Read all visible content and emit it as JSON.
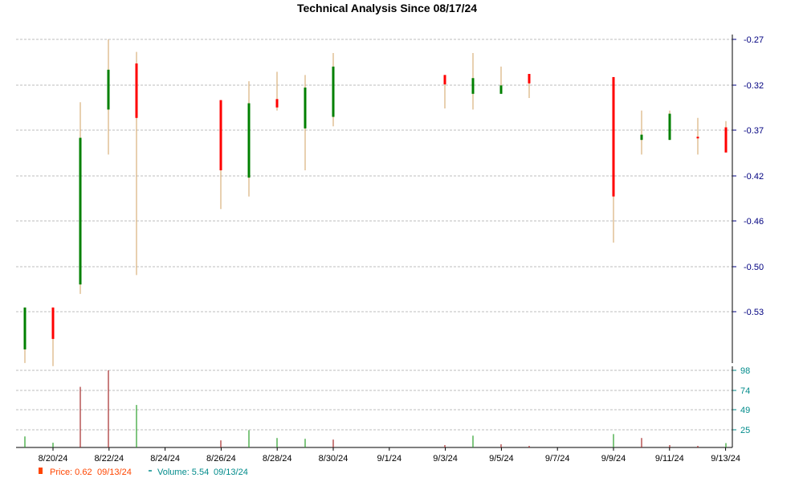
{
  "chart_data": {
    "type": "candlestick",
    "title": "Technical Analysis Since 08/17/24",
    "colors": {
      "up": "#008000",
      "down": "#ff0000",
      "wick": "#d2a060",
      "volume_up": "#2ca02c",
      "volume_down": "#a52a2a",
      "axis_price": "#000080",
      "axis_volume": "#008b8b",
      "grid": "#bdbdbd",
      "legend_price": "#ff4500",
      "legend_volume": "#008b8b"
    },
    "x_labels": [
      "8/20/24",
      "8/22/24",
      "8/24/24",
      "8/26/24",
      "8/28/24",
      "8/30/24",
      "9/1/24",
      "9/3/24",
      "9/5/24",
      "9/7/24",
      "9/9/24",
      "9/11/24",
      "9/13/24"
    ],
    "price_axis": {
      "ticks": [
        "-0.27",
        "-0.32",
        "-0.37",
        "-0.42",
        "-0.46",
        "-0.50",
        "-0.53"
      ],
      "range": [
        -0.27,
        -0.53
      ],
      "grid": true
    },
    "volume_axis": {
      "ticks": [
        "98",
        "74",
        "49",
        "25"
      ],
      "range": [
        0,
        98
      ],
      "grid": true
    },
    "candles": [
      {
        "date": "8/19",
        "open": -0.566,
        "close": -0.526,
        "high": -0.526,
        "low": -0.579,
        "dir": "up"
      },
      {
        "date": "8/20",
        "open": -0.526,
        "close": -0.556,
        "high": -0.526,
        "low": -0.582,
        "dir": "down"
      },
      {
        "date": "8/21",
        "open": -0.504,
        "close": -0.364,
        "high": -0.33,
        "low": -0.513,
        "dir": "up"
      },
      {
        "date": "8/22",
        "open": -0.337,
        "close": -0.299,
        "high": -0.27,
        "low": -0.38,
        "dir": "up"
      },
      {
        "date": "8/23",
        "open": -0.293,
        "close": -0.345,
        "high": -0.282,
        "low": -0.495,
        "dir": "down"
      },
      {
        "date": "8/26",
        "open": -0.328,
        "close": -0.395,
        "high": -0.328,
        "low": -0.432,
        "dir": "down"
      },
      {
        "date": "8/27",
        "open": -0.402,
        "close": -0.331,
        "high": -0.31,
        "low": -0.42,
        "dir": "up"
      },
      {
        "date": "8/28",
        "open": -0.327,
        "close": -0.335,
        "high": -0.301,
        "low": -0.338,
        "dir": "down"
      },
      {
        "date": "8/29",
        "open": -0.355,
        "close": -0.316,
        "high": -0.304,
        "low": -0.395,
        "dir": "up"
      },
      {
        "date": "8/30",
        "open": -0.344,
        "close": -0.296,
        "high": -0.283,
        "low": -0.353,
        "dir": "up"
      },
      {
        "date": "9/3",
        "open": -0.304,
        "close": -0.313,
        "high": -0.304,
        "low": -0.336,
        "dir": "down"
      },
      {
        "date": "9/4",
        "open": -0.322,
        "close": -0.307,
        "high": -0.283,
        "low": -0.337,
        "dir": "up"
      },
      {
        "date": "9/5",
        "open": -0.322,
        "close": -0.314,
        "high": -0.296,
        "low": -0.322,
        "dir": "up"
      },
      {
        "date": "9/6",
        "open": -0.303,
        "close": -0.312,
        "high": -0.303,
        "low": -0.326,
        "dir": "down"
      },
      {
        "date": "9/9",
        "open": -0.306,
        "close": -0.42,
        "high": -0.306,
        "low": -0.464,
        "dir": "down"
      },
      {
        "date": "9/10",
        "open": -0.366,
        "close": -0.361,
        "high": -0.338,
        "low": -0.38,
        "dir": "up"
      },
      {
        "date": "9/11",
        "open": -0.366,
        "close": -0.341,
        "high": -0.338,
        "low": -0.366,
        "dir": "up"
      },
      {
        "date": "9/12",
        "open": -0.363,
        "close": -0.363,
        "high": -0.345,
        "low": -0.38,
        "dir": "down"
      },
      {
        "date": "9/13",
        "open": -0.354,
        "close": -0.378,
        "high": -0.348,
        "low": -0.378,
        "dir": "down"
      }
    ],
    "volume": [
      {
        "date": "8/19",
        "value": 14,
        "dir": "up"
      },
      {
        "date": "8/20",
        "value": 6,
        "dir": "up"
      },
      {
        "date": "8/21",
        "value": 77,
        "dir": "down"
      },
      {
        "date": "8/22",
        "value": 98,
        "dir": "down"
      },
      {
        "date": "8/23",
        "value": 54,
        "dir": "up"
      },
      {
        "date": "8/26",
        "value": 9,
        "dir": "down"
      },
      {
        "date": "8/27",
        "value": 22,
        "dir": "up"
      },
      {
        "date": "8/28",
        "value": 12,
        "dir": "up"
      },
      {
        "date": "8/29",
        "value": 11,
        "dir": "up"
      },
      {
        "date": "8/30",
        "value": 10,
        "dir": "down"
      },
      {
        "date": "9/3",
        "value": 3,
        "dir": "down"
      },
      {
        "date": "9/4",
        "value": 15,
        "dir": "up"
      },
      {
        "date": "9/5",
        "value": 4,
        "dir": "down"
      },
      {
        "date": "9/6",
        "value": 2,
        "dir": "down"
      },
      {
        "date": "9/9",
        "value": 17,
        "dir": "up"
      },
      {
        "date": "9/10",
        "value": 12,
        "dir": "down"
      },
      {
        "date": "9/11",
        "value": 3,
        "dir": "down"
      },
      {
        "date": "9/12",
        "value": 2,
        "dir": "down"
      },
      {
        "date": "9/13",
        "value": 5.54,
        "dir": "up"
      }
    ],
    "legend": {
      "price_label": "Price: 0.62",
      "price_date": "09/13/24",
      "volume_label": "Volume: 5.54",
      "volume_date": "09/13/24",
      "placement": "bottom-left"
    }
  }
}
